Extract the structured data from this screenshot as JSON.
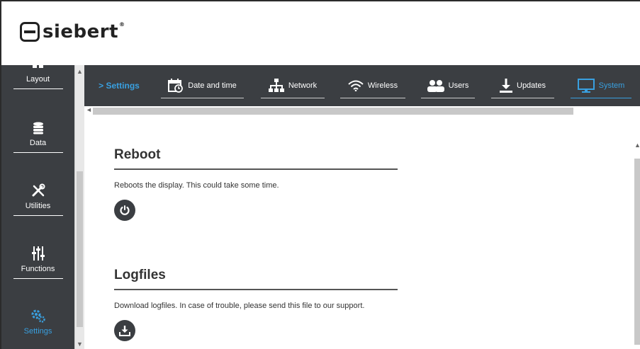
{
  "brand": {
    "name": "siebert",
    "reg": "®"
  },
  "sidebar": {
    "items": [
      {
        "label": "Layout",
        "icon": "layout-icon"
      },
      {
        "label": "Data",
        "icon": "database-icon"
      },
      {
        "label": "Utilities",
        "icon": "tools-icon"
      },
      {
        "label": "Functions",
        "icon": "sliders-icon"
      },
      {
        "label": "Settings",
        "icon": "gears-icon",
        "active": true
      }
    ]
  },
  "tabs": {
    "breadcrumb": "> Settings",
    "items": [
      {
        "label": "Date and time",
        "icon": "calendar-clock-icon"
      },
      {
        "label": "Network",
        "icon": "network-icon"
      },
      {
        "label": "Wireless",
        "icon": "wifi-icon"
      },
      {
        "label": "Users",
        "icon": "users-icon"
      },
      {
        "label": "Updates",
        "icon": "download-icon"
      },
      {
        "label": "System",
        "icon": "monitor-icon",
        "active": true
      }
    ]
  },
  "content": {
    "reboot": {
      "title": "Reboot",
      "description": "Reboots the display. This could take some time."
    },
    "logfiles": {
      "title": "Logfiles",
      "description": "Download logfiles. In case of trouble, please send this file to our support."
    }
  },
  "colors": {
    "accent": "#39a0e0",
    "dark": "#3b3e42"
  }
}
